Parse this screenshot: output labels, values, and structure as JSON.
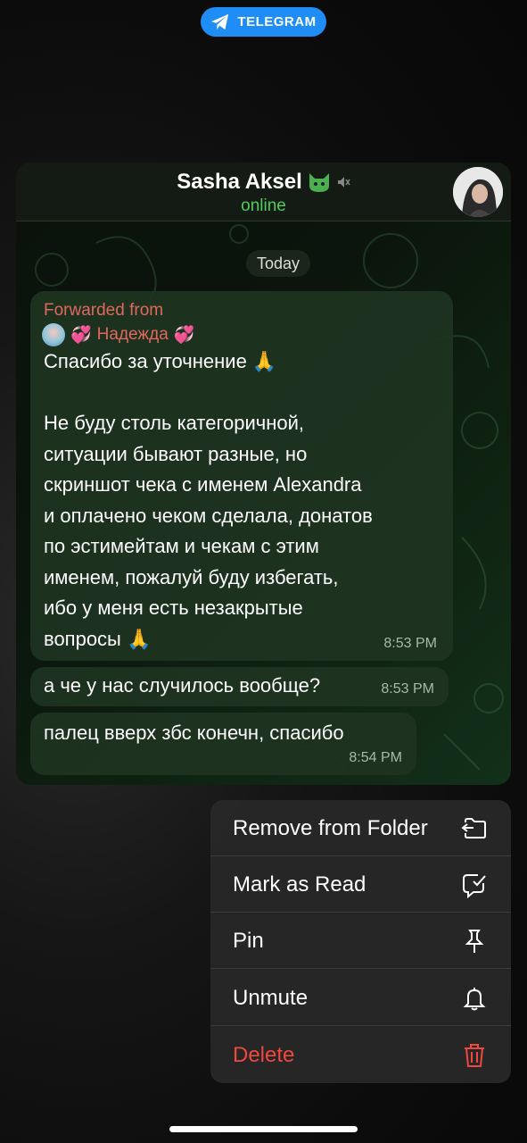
{
  "top_pill": {
    "label": "TELEGRAM"
  },
  "chat": {
    "name": "Sasha Aksel",
    "name_emoji": "cat-face",
    "muted_icon": "speaker-mute-icon",
    "status": "online",
    "date_divider": "Today"
  },
  "messages": [
    {
      "forwarded_label": "Forwarded from",
      "forwarded_from": "Надежда",
      "text": "Спасибо за уточнение 🙏\n\nНе буду столь категоричной,\nситуации бывают разные, но\nскриншот чека с именем Alexandra\nи  оплачено чеком сделала, донатов\nпо эстимейтам и чекам с этим\nименем, пожалуй буду избегать,\nибо у меня есть незакрытые\nвопросы 🙏",
      "time": "8:53 PM"
    },
    {
      "text": "а че у нас случилось вообще?",
      "time": "8:53 PM"
    },
    {
      "text": "палец вверх збс конечн, спасибо",
      "time": "8:54 PM"
    }
  ],
  "menu": {
    "items": [
      {
        "label": "Remove from Folder",
        "icon": "folder-remove-icon"
      },
      {
        "label": "Mark as Read",
        "icon": "chat-check-icon"
      },
      {
        "label": "Pin",
        "icon": "pin-icon"
      },
      {
        "label": "Unmute",
        "icon": "bell-icon"
      },
      {
        "label": "Delete",
        "icon": "trash-icon",
        "color": "#f0473e"
      }
    ]
  },
  "colors": {
    "telegram_blue": "#1e8df5",
    "online_green": "#4fcc5b",
    "forward_red": "#e0685e",
    "delete_red": "#f0473e"
  }
}
